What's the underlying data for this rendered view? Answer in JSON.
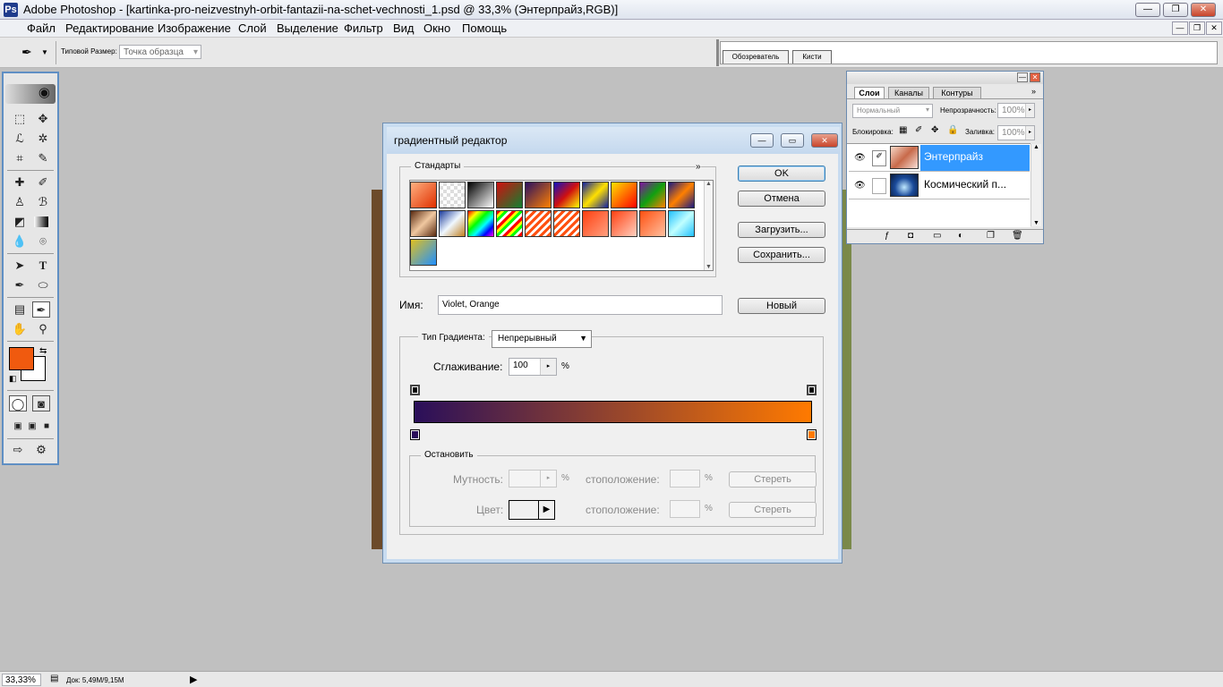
{
  "app": {
    "title": "Adobe Photoshop - [kartinka-pro-neizvestnyh-orbit-fantazii-na-schet-vechnosti_1.psd @ 33,3% (Энтерпрайз,RGB)]",
    "logo_letter": "Ps"
  },
  "menu": [
    "Файл",
    "Редактирование",
    "Изображение",
    "Слой",
    "Выделение",
    "Фильтр",
    "Вид",
    "Окно",
    "Помощь"
  ],
  "options": {
    "sample_size_label": "Типовой Размер:",
    "sample_size_value": "Точка образца",
    "palette_tabs": [
      "Обозреватель",
      "Кисти"
    ]
  },
  "colors": {
    "foreground": "#f05a0f",
    "background": "#ffffff",
    "accent": "#3399ff",
    "gradient_start": "#2a0f5a",
    "gradient_end": "#ff7a00"
  },
  "dialog": {
    "title": "градиентный редактор",
    "presets_label": "Стандарты",
    "presets_menu": "»",
    "buttons": {
      "ok": "OK",
      "cancel": "Отмена",
      "load": "Загрузить...",
      "save": "Сохранить...",
      "new": "Новый"
    },
    "name_label": "Имя:",
    "name_value": "Violet, Orange",
    "type_label": "Тип Градиента:",
    "type_value": "Непрерывный",
    "smooth_label": "Сглаживание:",
    "smooth_value": "100",
    "smooth_unit": "%",
    "stops": {
      "label": "Остановить",
      "opacity_label": "Мутность:",
      "opacity_unit": "%",
      "location_label": "стоположение:",
      "location_unit": "%",
      "delete_label": "Стереть",
      "color_label": "Цвет:",
      "location_label_2": "стоположение:",
      "location_unit_2": "%",
      "delete_label_2": "Стереть"
    }
  },
  "layers_panel": {
    "tabs": [
      "Слои",
      "Каналы",
      "Контуры"
    ],
    "blend_mode": "Нормальный",
    "opacity_label": "Непрозрачность:",
    "opacity_value": "100%",
    "lock_label": "Блокировка:",
    "fill_label": "Заливка:",
    "fill_value": "100%",
    "layers": [
      {
        "name": "Энтерпрайз",
        "selected": true
      },
      {
        "name": "Космический п...",
        "selected": false
      }
    ]
  },
  "status": {
    "zoom": "33,33%",
    "doc": "Док: 5,49M/9,15M"
  }
}
